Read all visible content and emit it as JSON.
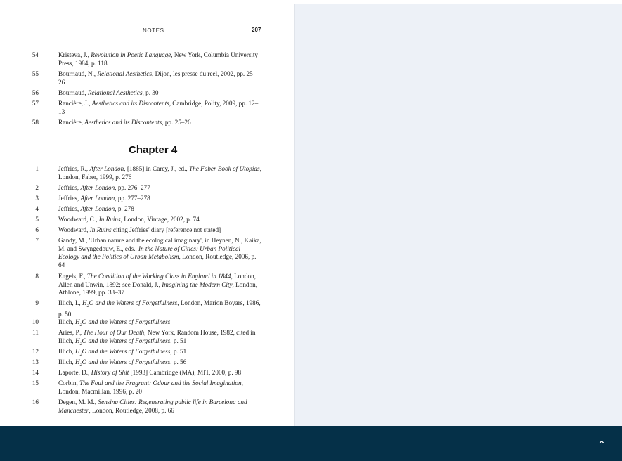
{
  "header": {
    "running_head": "NOTES",
    "page_number": "207"
  },
  "prev_notes": [
    {
      "num": "54",
      "parts": [
        [
          "Kristeva, J., ",
          0
        ],
        [
          "Revolution in Poetic Language",
          1
        ],
        [
          ", New York, Columbia University Press, 1984, p. 118",
          0
        ]
      ]
    },
    {
      "num": "55",
      "parts": [
        [
          "Bourriaud, N., ",
          0
        ],
        [
          "Relational Aesthetics",
          1
        ],
        [
          ", Dijon, les presse du reel, 2002, pp. 25–26",
          0
        ]
      ]
    },
    {
      "num": "56",
      "parts": [
        [
          "Bourriaud, ",
          0
        ],
        [
          "Relational Aesthetics",
          1
        ],
        [
          ", p. 30",
          0
        ]
      ]
    },
    {
      "num": "57",
      "parts": [
        [
          "Rancière, J., ",
          0
        ],
        [
          "Aesthetics and its Discontents",
          1
        ],
        [
          ", Cambridge, Polity, 2009, pp. 12–13",
          0
        ]
      ]
    },
    {
      "num": "58",
      "parts": [
        [
          "Rancière, ",
          0
        ],
        [
          "Aesthetics and its Discontents",
          1
        ],
        [
          ", pp. 25–26",
          0
        ]
      ]
    }
  ],
  "chapter_title": "Chapter 4",
  "chapter_notes": [
    {
      "num": "1",
      "parts": [
        [
          "Jeffries, R., ",
          0
        ],
        [
          "After London",
          1
        ],
        [
          ", [1885] in Carey, J., ed., ",
          0
        ],
        [
          "The Faber Book of Utopias",
          1
        ],
        [
          ", London, Faber, 1999, p. 276",
          0
        ]
      ]
    },
    {
      "num": "2",
      "parts": [
        [
          "Jeffries, ",
          0
        ],
        [
          "After London",
          1
        ],
        [
          ", pp. 276–277",
          0
        ]
      ]
    },
    {
      "num": "3",
      "parts": [
        [
          "Jeffries, ",
          0
        ],
        [
          "After London",
          1
        ],
        [
          ", pp. 277–278",
          0
        ]
      ]
    },
    {
      "num": "4",
      "parts": [
        [
          "Jeffries, ",
          0
        ],
        [
          "After London",
          1
        ],
        [
          ", p. 278",
          0
        ]
      ]
    },
    {
      "num": "5",
      "parts": [
        [
          "Woodward, C., ",
          0
        ],
        [
          "In Ruins",
          1
        ],
        [
          ", London, Vintage, 2002, p. 74",
          0
        ]
      ]
    },
    {
      "num": "6",
      "parts": [
        [
          "Woodward, ",
          0
        ],
        [
          "In Ruins",
          1
        ],
        [
          " citing Jeffries' diary [reference not stated]",
          0
        ]
      ]
    },
    {
      "num": "7",
      "parts": [
        [
          "Gandy, M., 'Urban nature and the ecological imaginary', in Heynen, N., Kaika, M. and Swyngedouw, E., eds., ",
          0
        ],
        [
          "In the Nature of Cities: Urban Political Ecology and the Politics of Urban Metabolism",
          1
        ],
        [
          ", London, Routledge, 2006, p. 64",
          0
        ]
      ]
    },
    {
      "num": "8",
      "parts": [
        [
          "Engels, F., ",
          0
        ],
        [
          "The Condition of the Working Class in England in 1844",
          1
        ],
        [
          ", London, Allen and Unwin, 1892; see Donald, J., ",
          0
        ],
        [
          "Imagining the Modern City",
          1
        ],
        [
          ", London, Athlone, 1999, pp. 33–37",
          0
        ]
      ]
    },
    {
      "num": "9",
      "parts": [
        [
          "Illich, I., ",
          0
        ],
        [
          "H",
          1
        ],
        [
          "2",
          2
        ],
        [
          "O and the Waters of Forgetfulness",
          1
        ],
        [
          ", London, Marion Boyars, 1986, p. 50",
          0
        ]
      ]
    },
    {
      "num": "10",
      "parts": [
        [
          "Illich, ",
          0
        ],
        [
          "H",
          1
        ],
        [
          "2",
          2
        ],
        [
          "O and the Waters of Forgetfulness",
          1
        ]
      ]
    },
    {
      "num": "11",
      "parts": [
        [
          "Aries, P., ",
          0
        ],
        [
          "The Hour of Our Death",
          1
        ],
        [
          ", New York, Random House, 1982, cited in Illich, ",
          0
        ],
        [
          "H",
          1
        ],
        [
          "2",
          2
        ],
        [
          "O and the Waters of Forgetfulness",
          1
        ],
        [
          ", p. 51",
          0
        ]
      ]
    },
    {
      "num": "12",
      "parts": [
        [
          "Illich, ",
          0
        ],
        [
          "H",
          1
        ],
        [
          "2",
          2
        ],
        [
          "O and the Waters of Forgetfulness",
          1
        ],
        [
          ", p. 51",
          0
        ]
      ]
    },
    {
      "num": "13",
      "parts": [
        [
          "Illich, ",
          0
        ],
        [
          "H",
          1
        ],
        [
          "2",
          2
        ],
        [
          "O and the Waters of Forgetfulness",
          1
        ],
        [
          ", p. 56",
          0
        ]
      ]
    },
    {
      "num": "14",
      "parts": [
        [
          "Laporte, D., ",
          0
        ],
        [
          "History of Shit",
          1
        ],
        [
          " [1993] Cambridge (MA), MIT, 2000, p. 98",
          0
        ]
      ]
    },
    {
      "num": "15",
      "parts": [
        [
          "Corbin, ",
          0
        ],
        [
          "The Foul and the Fragrant: Odour and the Social Imagination",
          1
        ],
        [
          ", London, Macmillan, 1996, p. 20",
          0
        ]
      ]
    },
    {
      "num": "16",
      "parts": [
        [
          "Degen, M. M., ",
          0
        ],
        [
          "Sensing Cities: Regenerating public life in Barcelona and Manchester",
          1
        ],
        [
          ", London, Routledge, 2008, p. 66",
          0
        ]
      ]
    }
  ],
  "footer": {
    "scroll_top_icon": "chevron-up-icon"
  },
  "colors": {
    "footer": "#053048",
    "background": "#edf1f7",
    "page": "#ffffff"
  }
}
